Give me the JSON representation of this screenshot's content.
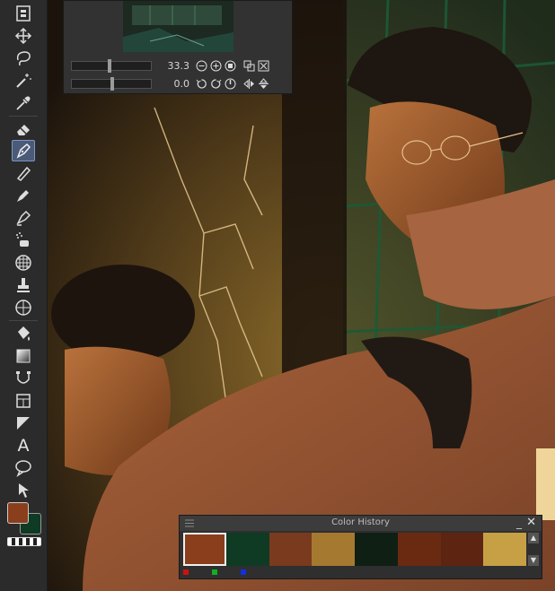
{
  "toolbar": {
    "tools": [
      {
        "name": "layer-property-tool",
        "icon": "layer-property-icon"
      },
      {
        "name": "move-tool",
        "icon": "move-arrows-icon"
      },
      {
        "name": "lasso-tool",
        "icon": "lasso-icon"
      },
      {
        "name": "magic-wand-tool",
        "icon": "magic-wand-icon"
      },
      {
        "name": "eyedropper-tool",
        "icon": "eyedropper-icon"
      },
      {
        "name": "eraser-tool",
        "icon": "eraser-icon"
      },
      {
        "name": "pen-tool",
        "icon": "pen-nib-icon",
        "active": true
      },
      {
        "name": "pencil-tool",
        "icon": "pencil-icon"
      },
      {
        "name": "brush-tool",
        "icon": "brush-icon"
      },
      {
        "name": "inking-tool",
        "icon": "ink-pen-icon"
      },
      {
        "name": "airbrush-tool",
        "icon": "airbrush-icon"
      },
      {
        "name": "decoration-tool",
        "icon": "decoration-pattern-icon"
      },
      {
        "name": "stamp-tool",
        "icon": "stamp-icon"
      },
      {
        "name": "blend-tool",
        "icon": "blend-grid-icon"
      },
      {
        "name": "fill-tool",
        "icon": "fill-bucket-icon"
      },
      {
        "name": "gradient-tool",
        "icon": "gradient-icon"
      },
      {
        "name": "figure-tool",
        "icon": "curve-figure-icon"
      },
      {
        "name": "frame-border-tool",
        "icon": "frame-border-icon"
      },
      {
        "name": "ruler-tool",
        "icon": "ruler-triangle-icon"
      },
      {
        "name": "text-tool",
        "icon": "text-icon",
        "glyph": "A"
      },
      {
        "name": "balloon-tool",
        "icon": "speech-balloon-icon"
      },
      {
        "name": "correct-line-tool",
        "icon": "cursor-arrow-icon"
      }
    ],
    "main_color": "#8a3e1c",
    "sub_color": "#0f3a23"
  },
  "navigator": {
    "zoom_value": "33.3",
    "rotation_value": "0.0",
    "zoom_slider_fraction": 0.46,
    "rotation_slider_fraction": 0.5,
    "icons": [
      "zoom-out-icon",
      "zoom-in-icon",
      "fit-stop-icon",
      "actual-size-icon",
      "fit-window-icon",
      "rotate-left-icon",
      "rotate-right-icon",
      "reset-rotation-icon",
      "flip-horizontal-icon",
      "flip-vertical-icon"
    ]
  },
  "color_history": {
    "title": "Color History",
    "minimize_glyph": "_",
    "close_glyph": "✕",
    "swatches": [
      "#8a3e1c",
      "#0f3a23",
      "#7a3a1e",
      "#a57a30",
      "#0f1f14",
      "#6a2a12",
      "#5e2412",
      "#c7a045"
    ],
    "selected_index": 0,
    "scroll_up_glyph": "▲",
    "scroll_down_glyph": "▼",
    "indicator_colors": [
      "#d01010",
      "#10b020",
      "#1030e0"
    ]
  }
}
